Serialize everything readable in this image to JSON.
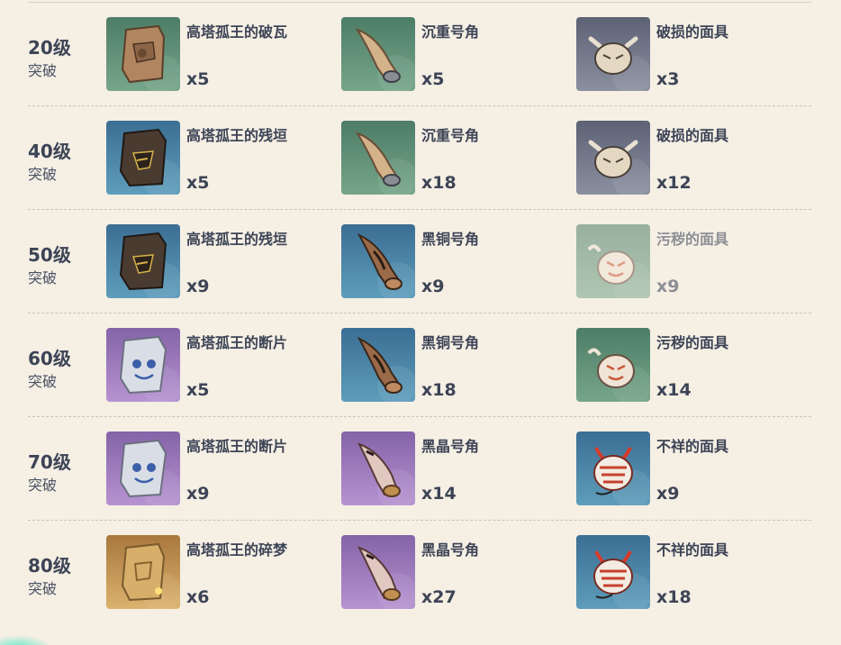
{
  "rows": [
    {
      "level": "20级",
      "sub": "突破",
      "items": [
        {
          "name": "高塔孤王的破瓦",
          "qty": "x5",
          "icon": "broken-tile-icon",
          "bg": "green"
        },
        {
          "name": "沉重号角",
          "qty": "x5",
          "icon": "horn-icon",
          "bg": "green"
        },
        {
          "name": "破损的面具",
          "qty": "x3",
          "icon": "damaged-mask-icon",
          "bg": "gray"
        }
      ]
    },
    {
      "level": "40级",
      "sub": "突破",
      "items": [
        {
          "name": "高塔孤王的残垣",
          "qty": "x5",
          "icon": "ruined-wall-icon",
          "bg": "blue"
        },
        {
          "name": "沉重号角",
          "qty": "x18",
          "icon": "horn-icon",
          "bg": "green"
        },
        {
          "name": "破损的面具",
          "qty": "x12",
          "icon": "damaged-mask-icon",
          "bg": "gray"
        }
      ]
    },
    {
      "level": "50级",
      "sub": "突破",
      "items": [
        {
          "name": "高塔孤王的残垣",
          "qty": "x9",
          "icon": "ruined-wall-icon",
          "bg": "blue"
        },
        {
          "name": "黑铜号角",
          "qty": "x9",
          "icon": "black-bronze-horn-icon",
          "bg": "blue"
        },
        {
          "name": "污秽的面具",
          "qty": "x9",
          "icon": "stained-mask-icon",
          "bg": "green",
          "dim": true
        }
      ]
    },
    {
      "level": "60级",
      "sub": "突破",
      "items": [
        {
          "name": "高塔孤王的断片",
          "qty": "x5",
          "icon": "fragment-icon",
          "bg": "purple"
        },
        {
          "name": "黑铜号角",
          "qty": "x18",
          "icon": "black-bronze-horn-icon",
          "bg": "blue"
        },
        {
          "name": "污秽的面具",
          "qty": "x14",
          "icon": "stained-mask-icon",
          "bg": "green"
        }
      ]
    },
    {
      "level": "70级",
      "sub": "突破",
      "items": [
        {
          "name": "高塔孤王的断片",
          "qty": "x9",
          "icon": "fragment-icon",
          "bg": "purple"
        },
        {
          "name": "黑晶号角",
          "qty": "x14",
          "icon": "black-crystal-horn-icon",
          "bg": "purple"
        },
        {
          "name": "不祥的面具",
          "qty": "x9",
          "icon": "ominous-mask-icon",
          "bg": "blue"
        }
      ]
    },
    {
      "level": "80级",
      "sub": "突破",
      "items": [
        {
          "name": "高塔孤王的碎梦",
          "qty": "x6",
          "icon": "shattered-dream-icon",
          "bg": "gold"
        },
        {
          "name": "黑晶号角",
          "qty": "x27",
          "icon": "black-crystal-horn-icon",
          "bg": "purple"
        },
        {
          "name": "不祥的面具",
          "qty": "x18",
          "icon": "ominous-mask-icon",
          "bg": "blue"
        }
      ]
    }
  ],
  "colors": {
    "page_bg": "#f5efe4",
    "text": "#3d4456",
    "divider": "#cdc3b3",
    "green": "#5b8a6e",
    "gray": "#6d7385",
    "blue": "#4a7f9e",
    "purple": "#9a78b8",
    "gold": "#c99a55"
  }
}
